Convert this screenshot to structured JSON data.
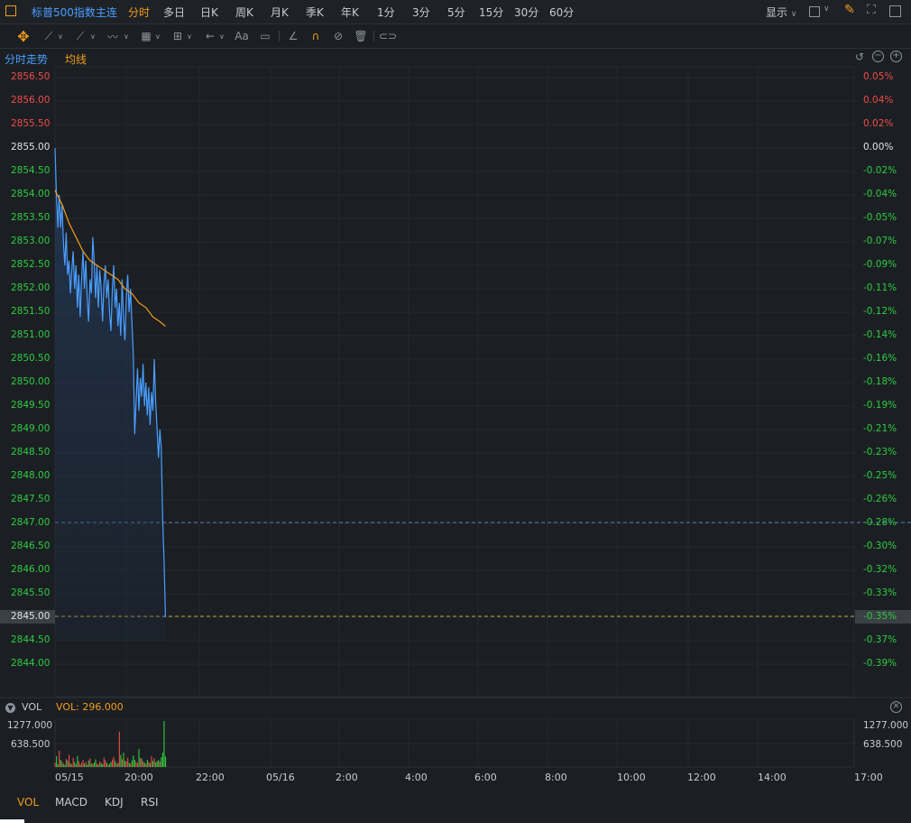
{
  "top": {
    "title": "标普500指数主连",
    "periods": [
      "分时",
      "多日",
      "日K",
      "周K",
      "月K",
      "季K",
      "年K",
      "1分",
      "3分",
      "5分",
      "15分",
      "30分",
      "60分"
    ],
    "active_period": "分时",
    "display_label": "显示"
  },
  "sub": {
    "mode": "分时走势",
    "ma_label": "均线"
  },
  "axis": {
    "left": [
      "2856.50",
      "2856.00",
      "2855.50",
      "2855.00",
      "2854.50",
      "2854.00",
      "2853.50",
      "2853.00",
      "2852.50",
      "2852.00",
      "2851.50",
      "2851.00",
      "2850.50",
      "2850.00",
      "2849.50",
      "2849.00",
      "2848.50",
      "2848.00",
      "2847.50",
      "2847.00",
      "2846.50",
      "2846.00",
      "2845.50",
      "2845.00",
      "2844.50",
      "2844.00"
    ],
    "right": [
      "0.05%",
      "0.04%",
      "0.02%",
      "0.00%",
      "-0.02%",
      "-0.04%",
      "-0.05%",
      "-0.07%",
      "-0.09%",
      "-0.11%",
      "-0.12%",
      "-0.14%",
      "-0.16%",
      "-0.18%",
      "-0.19%",
      "-0.21%",
      "-0.23%",
      "-0.25%",
      "-0.26%",
      "-0.28%",
      "-0.30%",
      "-0.32%",
      "-0.33%",
      "-0.35%",
      "-0.37%",
      "-0.39%"
    ],
    "x": [
      "05/15",
      "20:00",
      "22:00",
      "05/16",
      "2:00",
      "4:00",
      "6:00",
      "8:00",
      "10:00",
      "12:00",
      "14:00",
      "17:00"
    ],
    "ref_price": "2855.00",
    "current_price": "2845.00",
    "current_pct": "-0.35%"
  },
  "volume": {
    "label": "VOL",
    "value_label": "VOL: 296.000",
    "max": "1277.000",
    "mid": "638.500",
    "max_r": "1277.000",
    "mid_r": "638.500"
  },
  "bottom_tabs": [
    "VOL",
    "MACD",
    "KDJ",
    "RSI"
  ],
  "colors": {
    "up": "#f04a4a",
    "down": "#2ecc40",
    "price_line": "#4a9eff",
    "avg_line": "#f39c1a",
    "accent": "#f39c1a"
  },
  "chart_data": {
    "type": "line",
    "title": "",
    "y_range": [
      2843.7,
      2856.6
    ],
    "series": [
      {
        "name": "",
        "points": [
          [
            0,
            2855.0
          ],
          [
            1,
            2854.0
          ],
          [
            2,
            2853.3
          ],
          [
            3,
            2854.0
          ],
          [
            4,
            2853.3
          ],
          [
            5,
            2853.8
          ],
          [
            6,
            2853.0
          ],
          [
            7,
            2852.5
          ],
          [
            8,
            2853.2
          ],
          [
            9,
            2852.3
          ],
          [
            10,
            2852.6
          ],
          [
            11,
            2851.9
          ],
          [
            12,
            2852.4
          ],
          [
            13,
            2852.8
          ],
          [
            14,
            2852.0
          ],
          [
            15,
            2852.5
          ],
          [
            16,
            2851.6
          ],
          [
            17,
            2852.3
          ],
          [
            18,
            2851.4
          ],
          [
            19,
            2852.2
          ],
          [
            20,
            2852.8
          ],
          [
            21,
            2852.0
          ],
          [
            22,
            2852.6
          ],
          [
            23,
            2851.8
          ],
          [
            24,
            2851.3
          ],
          [
            25,
            2852.2
          ],
          [
            26,
            2851.9
          ],
          [
            27,
            2853.1
          ],
          [
            28,
            2852.6
          ],
          [
            29,
            2851.8
          ],
          [
            30,
            2852.5
          ],
          [
            31,
            2851.6
          ],
          [
            32,
            2852.4
          ],
          [
            33,
            2852.0
          ],
          [
            34,
            2851.3
          ],
          [
            35,
            2852.1
          ],
          [
            36,
            2852.5
          ],
          [
            37,
            2851.8
          ],
          [
            38,
            2852.2
          ],
          [
            39,
            2851.5
          ],
          [
            40,
            2851.1
          ],
          [
            41,
            2852.0
          ],
          [
            42,
            2852.5
          ],
          [
            43,
            2851.6
          ],
          [
            44,
            2852.0
          ],
          [
            45,
            2851.2
          ],
          [
            46,
            2851.7
          ],
          [
            47,
            2851.0
          ],
          [
            48,
            2852.2
          ],
          [
            49,
            2851.4
          ],
          [
            50,
            2850.9
          ],
          [
            51,
            2851.8
          ],
          [
            52,
            2852.3
          ],
          [
            53,
            2851.5
          ],
          [
            54,
            2852.0
          ],
          [
            55,
            2851.3
          ],
          [
            56,
            2850.6
          ],
          [
            57,
            2848.9
          ],
          [
            58,
            2849.6
          ],
          [
            59,
            2850.3
          ],
          [
            60,
            2849.4
          ],
          [
            61,
            2850.1
          ],
          [
            62,
            2849.7
          ],
          [
            63,
            2850.4
          ],
          [
            64,
            2849.5
          ],
          [
            65,
            2850.0
          ],
          [
            66,
            2849.3
          ],
          [
            67,
            2849.9
          ],
          [
            68,
            2849.1
          ],
          [
            69,
            2849.8
          ],
          [
            70,
            2849.4
          ],
          [
            71,
            2850.5
          ],
          [
            72,
            2849.6
          ],
          [
            73,
            2849.0
          ],
          [
            74,
            2848.4
          ],
          [
            75,
            2849.0
          ],
          [
            76,
            2848.6
          ],
          [
            77,
            2847.1
          ],
          [
            78,
            2846.2
          ],
          [
            79,
            2845.0
          ]
        ]
      },
      {
        "name": "",
        "points": [
          [
            0,
            2854.1
          ],
          [
            5,
            2853.8
          ],
          [
            10,
            2853.4
          ],
          [
            15,
            2853.1
          ],
          [
            20,
            2852.8
          ],
          [
            25,
            2852.6
          ],
          [
            30,
            2852.5
          ],
          [
            35,
            2852.4
          ],
          [
            40,
            2852.3
          ],
          [
            45,
            2852.2
          ],
          [
            50,
            2852.0
          ],
          [
            55,
            2851.9
          ],
          [
            60,
            2851.7
          ],
          [
            65,
            2851.6
          ],
          [
            70,
            2851.4
          ],
          [
            75,
            2851.3
          ],
          [
            79,
            2851.2
          ]
        ]
      }
    ],
    "volume": [
      120,
      300,
      80,
      450,
      200,
      150,
      90,
      60,
      220,
      180,
      340,
      110,
      70,
      260,
      140,
      90,
      310,
      160,
      70,
      120,
      200,
      90,
      140,
      60,
      180,
      240,
      100,
      80,
      130,
      210,
      90,
      70,
      150,
      110,
      80,
      260,
      190,
      120,
      60,
      90,
      140,
      210,
      280,
      170,
      90,
      120,
      980,
      340,
      220,
      400,
      170,
      150,
      260,
      120,
      90,
      180,
      320,
      200,
      140,
      110,
      500,
      260,
      230,
      160,
      120,
      90,
      200,
      140,
      110,
      300,
      170,
      240,
      130,
      160,
      200,
      150,
      270,
      400,
      1277,
      296
    ]
  }
}
